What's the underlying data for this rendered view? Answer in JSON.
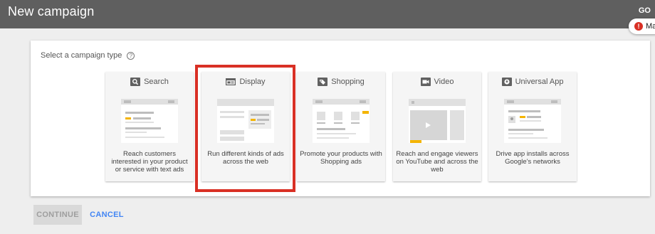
{
  "header": {
    "title": "New campaign",
    "right_text": "GO",
    "alert_text": "Ma"
  },
  "panel": {
    "label": "Select a campaign type",
    "help_icon": "question-circle-icon"
  },
  "cards": [
    {
      "title": "Search",
      "icon": "search-icon",
      "description": "Reach customers interested in your product or service with text ads"
    },
    {
      "title": "Display",
      "icon": "display-icon",
      "description": "Run different kinds of ads across the web"
    },
    {
      "title": "Shopping",
      "icon": "tag-icon",
      "description": "Promote your products with Shopping ads"
    },
    {
      "title": "Video",
      "icon": "videocam-icon",
      "description": "Reach and engage viewers on YouTube and across the web"
    },
    {
      "title": "Universal App",
      "icon": "download-icon",
      "description": "Drive app installs across Google's networks"
    }
  ],
  "actions": {
    "continue_label": "CONTINUE",
    "cancel_label": "CANCEL"
  },
  "colors": {
    "header_bg": "#5f5f5f",
    "highlight": "#d93025",
    "accent": "#4285f4",
    "ad_yellow": "#f4b400"
  }
}
